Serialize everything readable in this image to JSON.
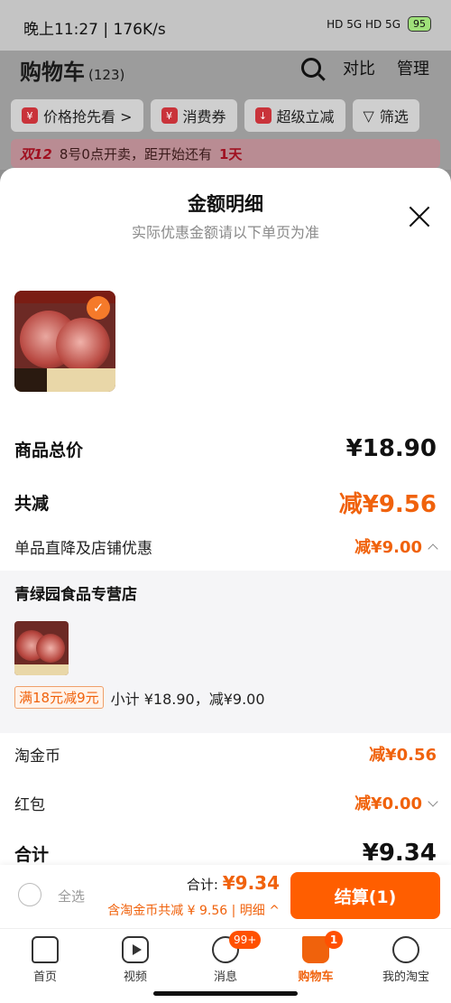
{
  "status_bar": {
    "time": "晚上11:27 | 176K/s",
    "network": "HD 5G HD 5G",
    "battery": "95"
  },
  "header": {
    "title": "购物车",
    "count": "(123)",
    "compare": "对比",
    "manage": "管理",
    "chips": [
      "价格抢先看 >",
      "消费券",
      "超级立减",
      "筛选"
    ],
    "promo": {
      "tag": "双12",
      "text": "8号0点开卖，距开始还有",
      "days": "1天"
    }
  },
  "sheet": {
    "title": "金额明细",
    "subtitle": "实际优惠金额请以下单页为准",
    "total_price_label": "商品总价",
    "total_price": "¥18.90",
    "reduce_label": "共减",
    "reduce_value": "减¥9.56",
    "direct_label": "单品直降及店铺优惠",
    "direct_value": "减¥9.00",
    "store": {
      "name": "青绿园食品专营店",
      "discount_tag": "满18元减9元",
      "subtotal": "小计 ¥18.90，减¥9.00"
    },
    "coin_label": "淘金币",
    "coin_value": "减¥0.56",
    "redpacket_label": "红包",
    "redpacket_value": "减¥0.00",
    "sum_label": "合计",
    "sum_value": "¥9.34"
  },
  "checkout": {
    "select_all": "全选",
    "total_prefix": "合计:",
    "total_amount": "¥9.34",
    "saved": "含淘金币共减 ¥ 9.56 | 明细",
    "button": "结算(1)"
  },
  "tabbar": {
    "tabs": [
      {
        "label": "首页"
      },
      {
        "label": "视频"
      },
      {
        "label": "消息",
        "badge": "99+"
      },
      {
        "label": "购物车",
        "badge": "1"
      },
      {
        "label": "我的淘宝"
      }
    ]
  },
  "colors": {
    "accent": "#ff5e00",
    "discount": "#f0620c"
  }
}
